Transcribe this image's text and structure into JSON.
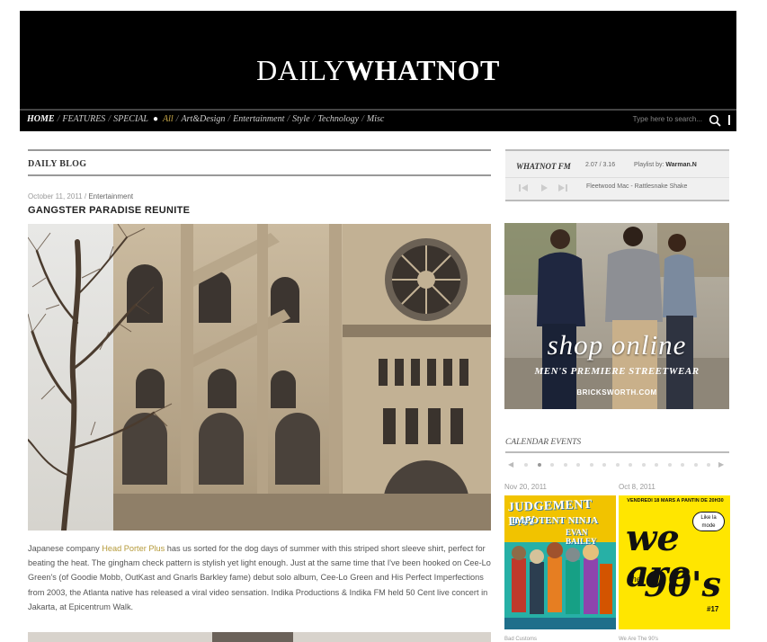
{
  "header": {
    "logo_light": "DAILY",
    "logo_bold": "WHATNOT"
  },
  "nav": {
    "items": [
      "HOME",
      "FEATURES",
      "SPECIAL",
      "All",
      "Art&Design",
      "Entertainment",
      "Style",
      "Technology",
      "Misc"
    ],
    "search_placeholder": "Type here to search...",
    "accent_color": "#c9a94a"
  },
  "blog": {
    "section_title": "DAILY BLOG",
    "post": {
      "date": "October 11, 2011",
      "separator": " / ",
      "category": "Entertainment",
      "title": "GANGSTER PARADISE REUNITE",
      "text_before_link": "Japanese company ",
      "link_text": "Head Porter Plus",
      "text_after_link": " has us sorted for the dog days of summer with this striped short sleeve shirt, perfect for beating the heat. The gingham check pattern is stylish yet light enough. Just at the same time that I've been hooked on Cee-Lo Green's (of Goodie Mobb, OutKast and Gnarls Barkley fame) debut solo album, Cee-Lo Green and His Perfect Imperfections from 2003, the Atlanta native has released a viral video sensation. Indika Productions & Indika FM held 50 Cent live concert in Jakarta, at Epicentrum Walk."
    }
  },
  "radio": {
    "title": "WHATNOT FM",
    "time": "2.07 / 3.16",
    "playlist_label": "Playlist by:",
    "playlist_by": "Warman.N",
    "track": "Fleetwood Mac - Rattlesnake Shake"
  },
  "ad": {
    "headline": "shop online",
    "subline": "MEN'S PREMIERE STREETWEAR",
    "site": "BRICKSWORTH.COM"
  },
  "calendar": {
    "title": "CALENDAR EVENTS",
    "active_index": 1,
    "total_dots": 15,
    "events": [
      {
        "date": "Nov 20, 2011",
        "poster_line1": "JUDGEMENT DAY",
        "poster_line2": "IMPOTENT NINJA",
        "poster_line3": "EVAN BAILEY",
        "title": "Bad Customs"
      },
      {
        "date": "Oct 8, 2011",
        "poster_top": "VENDREDI 18 MARS A PANTIN DE 20H30",
        "poster_badge": "Like la mode",
        "poster_we": "we are",
        "poster_the": "the",
        "poster_90s": "90's",
        "poster_num": "#17",
        "title": "We Are The 90's"
      }
    ]
  }
}
